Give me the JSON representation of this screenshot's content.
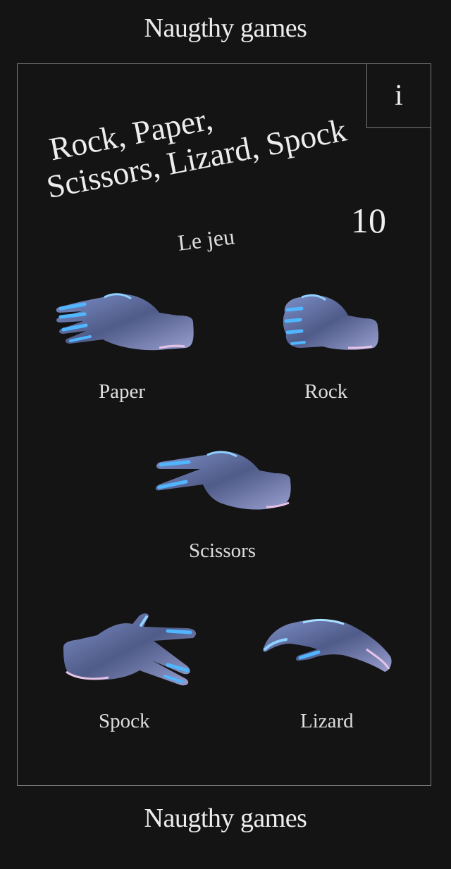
{
  "brand": {
    "top": "Naugthy games",
    "bottom": "Naugthy games"
  },
  "info_button": "i",
  "title": {
    "line1": "Rock, Paper,",
    "line2": "Scissors, Lizard, Spock"
  },
  "subtitle": "Le jeu",
  "score": "10",
  "choices": [
    {
      "id": "paper",
      "label": "Paper",
      "icon": "open-hand-icon"
    },
    {
      "id": "rock",
      "label": "Rock",
      "icon": "fist-icon"
    },
    {
      "id": "scissors",
      "label": "Scissors",
      "icon": "two-finger-hand-icon"
    },
    {
      "id": "spock",
      "label": "Spock",
      "icon": "vulcan-salute-icon"
    },
    {
      "id": "lizard",
      "label": "Lizard",
      "icon": "lizard-hand-icon"
    }
  ],
  "colors": {
    "background": "#141414",
    "border": "#7a7a7a",
    "text": "#ededed",
    "hand_base": "#5b6a9c",
    "hand_highlight": "#4fb6ff",
    "hand_shadow": "#2b3150"
  }
}
